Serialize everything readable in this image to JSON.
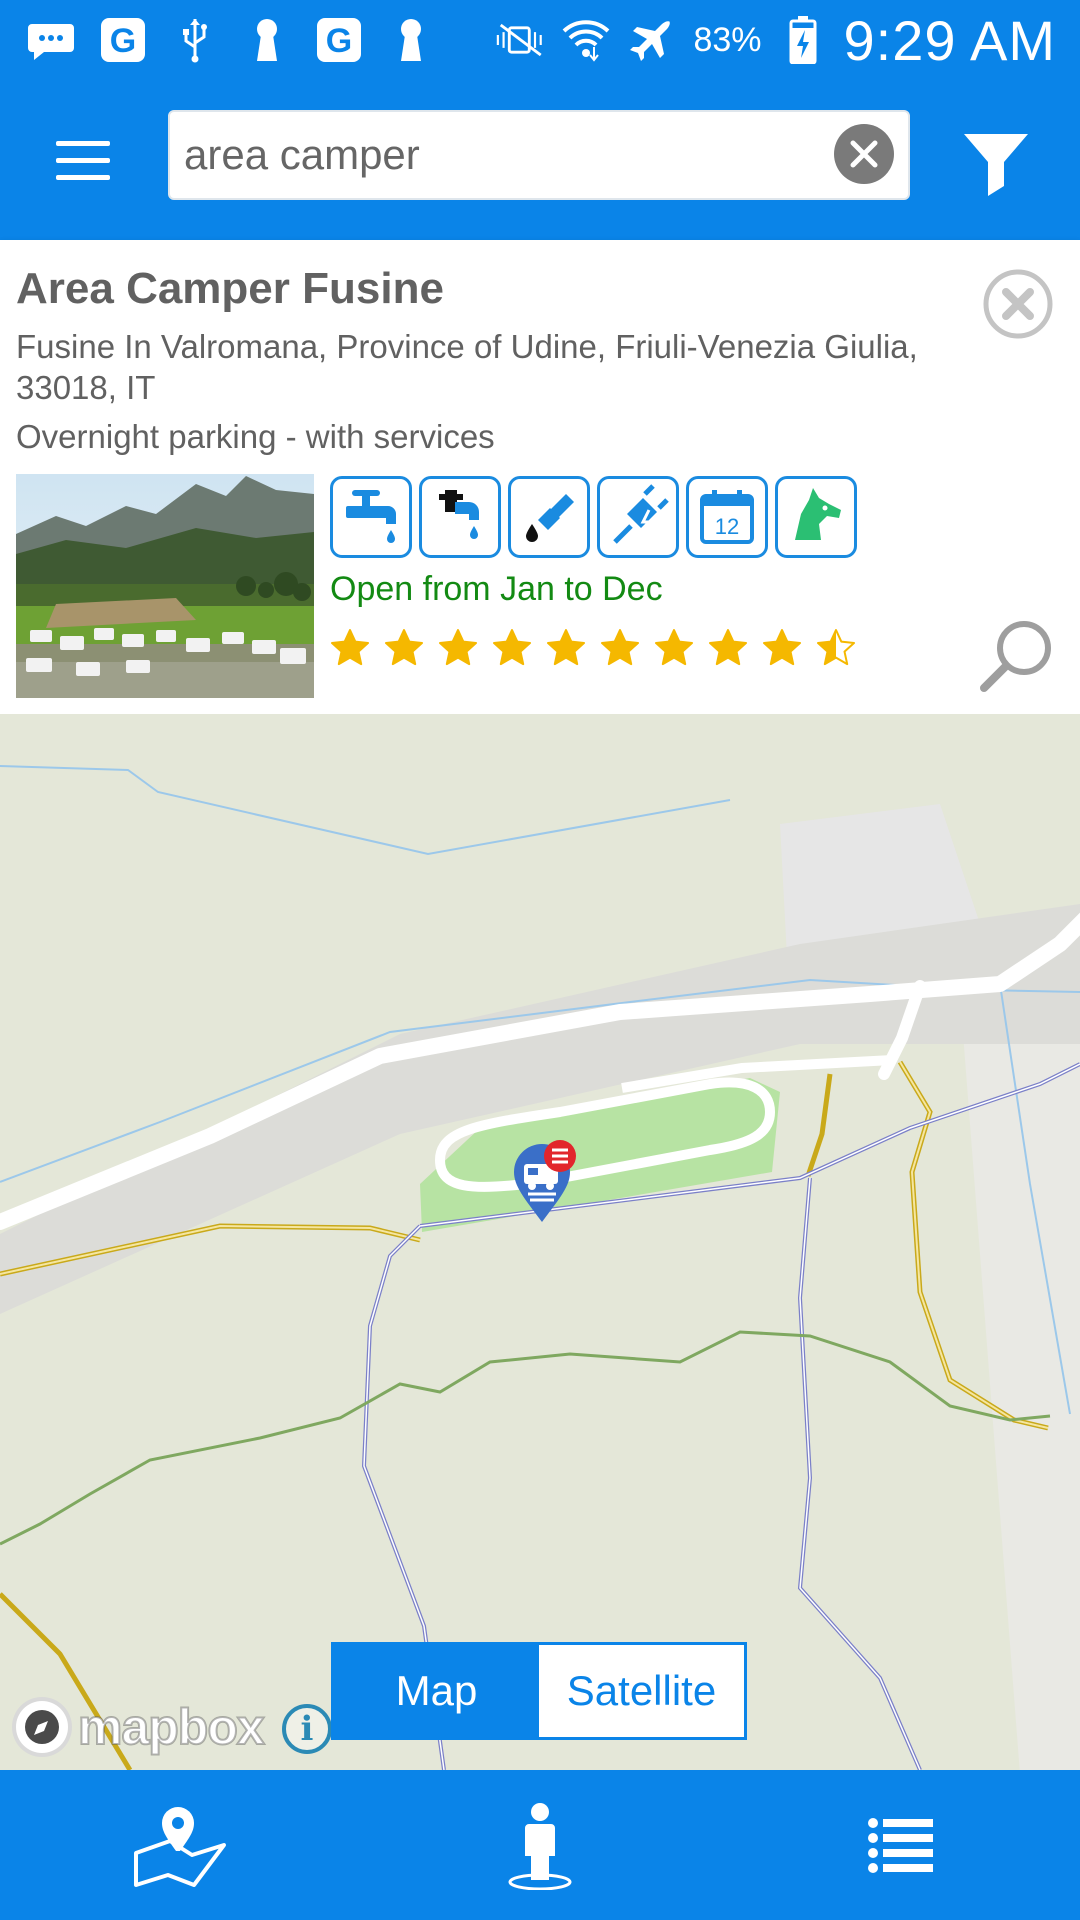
{
  "status_bar": {
    "battery": "83%",
    "time": "9:29 AM",
    "icons": [
      "message-icon",
      "google-icon",
      "usb-icon",
      "keyhole-icon",
      "google-icon",
      "keyhole-icon",
      "vibrate-icon",
      "wifi-icon",
      "airplane-icon",
      "battery-charging-icon"
    ]
  },
  "app_bar": {
    "menu_icon": "hamburger-icon",
    "search_value": "area camper",
    "clear_icon": "clear-icon",
    "filter_icon": "filter-icon"
  },
  "place_card": {
    "title": "Area Camper Fusine",
    "address": "Fusine In Valromana, Province of Udine, Friuli-Venezia Giulia, 33018, IT",
    "category": "Overnight parking - with services",
    "services": [
      "water-tap-icon",
      "grey-water-icon",
      "black-water-icon",
      "electricity-icon",
      "calendar-icon",
      "dog-icon"
    ],
    "calendar_day": "12",
    "open_text": "Open from Jan to Dec",
    "rating": 9.5,
    "rating_max": 10,
    "colors": {
      "service_border": "#1a8be0",
      "open_text": "#138a13",
      "star": "#f5b800"
    }
  },
  "map": {
    "toggle": {
      "map_label": "Map",
      "satellite_label": "Satellite",
      "selected": "Map"
    },
    "attribution": "mapbox",
    "info_label": "i",
    "marker_icon": "camper-marker-icon"
  },
  "bottom_nav": {
    "items": [
      "map-pin-icon",
      "person-icon",
      "list-icon"
    ]
  },
  "colors": {
    "primary": "#0a84e8",
    "map_background": "#e4e7d8"
  }
}
